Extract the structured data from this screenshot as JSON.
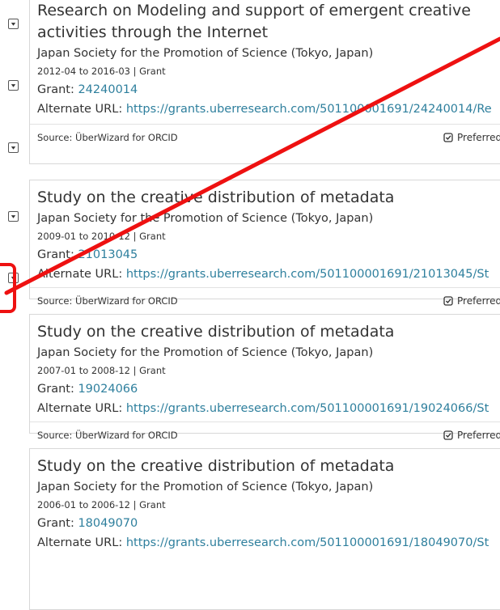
{
  "records": [
    {
      "title_lines": [
        "Research on Modeling and support of emergent creative",
        "activities through the Internet"
      ],
      "organization": "Japan Society for the Promotion of Science (Tokyo, Japan)",
      "dates": "2012-04 to 2016-03 | Grant",
      "grant_label": "Grant:",
      "grant_number": "24240014",
      "alt_label": "Alternate URL:",
      "alt_url": "https://grants.uberresearch.com/501100001691/24240014/Re",
      "source": "Source: ÜberWizard for ORCID",
      "preferred": "Preferred"
    },
    {
      "title_lines": [
        "Study on the creative distribution of metadata"
      ],
      "organization": "Japan Society for the Promotion of Science (Tokyo, Japan)",
      "dates": "2009-01 to 2010-12 | Grant",
      "grant_label": "Grant:",
      "grant_number": "21013045",
      "alt_label": "Alternate URL:",
      "alt_url": "https://grants.uberresearch.com/501100001691/21013045/St",
      "source": "Source: ÜberWizard for ORCID",
      "preferred": "Preferred"
    },
    {
      "title_lines": [
        "Study on the creative distribution of metadata"
      ],
      "organization": "Japan Society for the Promotion of Science (Tokyo, Japan)",
      "dates": "2007-01 to 2008-12 | Grant",
      "grant_label": "Grant:",
      "grant_number": "19024066",
      "alt_label": "Alternate URL:",
      "alt_url": "https://grants.uberresearch.com/501100001691/19024066/St",
      "source": "Source: ÜberWizard for ORCID",
      "preferred": "Preferred"
    },
    {
      "title_lines": [
        "Study on the creative distribution of metadata"
      ],
      "organization": "Japan Society for the Promotion of Science (Tokyo, Japan)",
      "dates": "2006-01 to 2006-12 | Grant",
      "grant_label": "Grant:",
      "grant_number": "18049070",
      "alt_label": "Alternate URL:",
      "alt_url": "https://grants.uberresearch.com/501100001691/18049070/St"
    }
  ],
  "toggles": [
    "chevron-down-icon",
    "chevron-down-icon",
    "chevron-down-icon",
    "chevron-down-icon",
    "chevron-down-icon",
    "chevron-down-icon"
  ],
  "colors": {
    "link": "#2e7f9d",
    "annotation": "#ee1111",
    "text": "#333333"
  }
}
